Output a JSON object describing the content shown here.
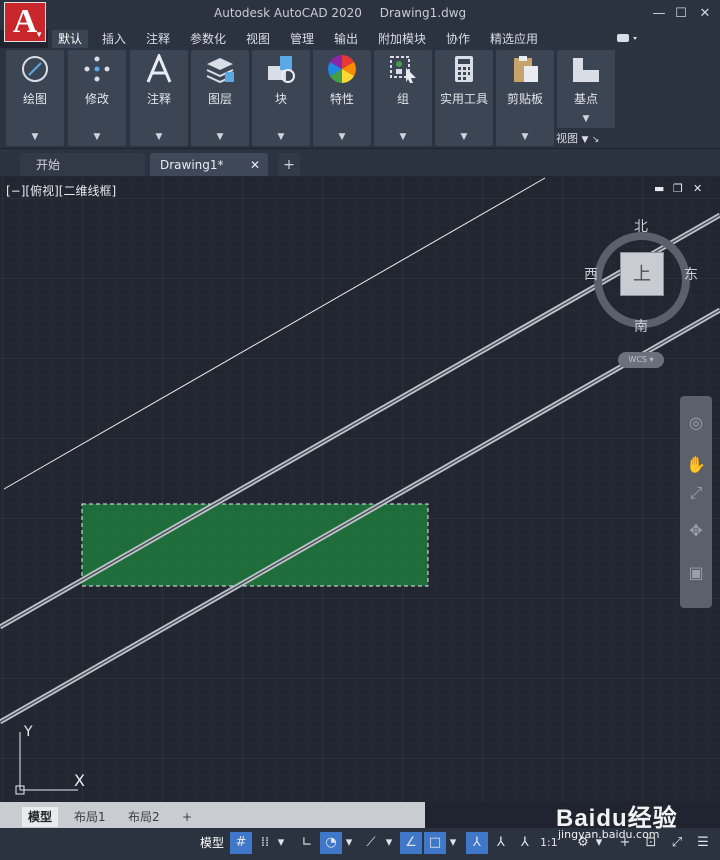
{
  "titlebar": {
    "app_name": "Autodesk AutoCAD 2020",
    "doc_name": "Drawing1.dwg",
    "logo_letter": "A"
  },
  "ribbon_tabs": [
    {
      "label": "默认",
      "active": true
    },
    {
      "label": "插入"
    },
    {
      "label": "注释"
    },
    {
      "label": "参数化"
    },
    {
      "label": "视图"
    },
    {
      "label": "管理"
    },
    {
      "label": "输出"
    },
    {
      "label": "附加模块"
    },
    {
      "label": "协作"
    },
    {
      "label": "精选应用"
    }
  ],
  "ribbon_panels": [
    {
      "label": "绘图",
      "icon": "draw-icon"
    },
    {
      "label": "修改",
      "icon": "modify-icon"
    },
    {
      "label": "注释",
      "icon": "annotation-icon"
    },
    {
      "label": "图层",
      "icon": "layers-icon"
    },
    {
      "label": "块",
      "icon": "block-icon"
    },
    {
      "label": "特性",
      "icon": "properties-icon"
    },
    {
      "label": "组",
      "icon": "group-icon"
    },
    {
      "label": "实用工具",
      "icon": "utilities-icon"
    },
    {
      "label": "剪贴板",
      "icon": "clipboard-icon"
    },
    {
      "label": "基点",
      "icon": "basepoint-icon"
    }
  ],
  "ribbon_view_label": "视图",
  "file_tabs": {
    "start": "开始",
    "drawing": "Drawing1*",
    "add": "+"
  },
  "viewport": {
    "label": "[−][俯视][二维线框]",
    "viewcube": {
      "north": "北",
      "south": "南",
      "east": "东",
      "west": "西",
      "face": "上"
    },
    "wcs": "WCS",
    "ucs_x": "X",
    "ucs_y": "Y",
    "selection_color": "#1e7a3c"
  },
  "layout_tabs": [
    {
      "label": "模型",
      "active": true
    },
    {
      "label": "布局1"
    },
    {
      "label": "布局2"
    },
    {
      "label": "+"
    }
  ],
  "statusbar": {
    "model": "模型",
    "scale": "1:1"
  },
  "watermark": {
    "main": "Baidu经验",
    "sub": "jingyan.baidu.com"
  }
}
